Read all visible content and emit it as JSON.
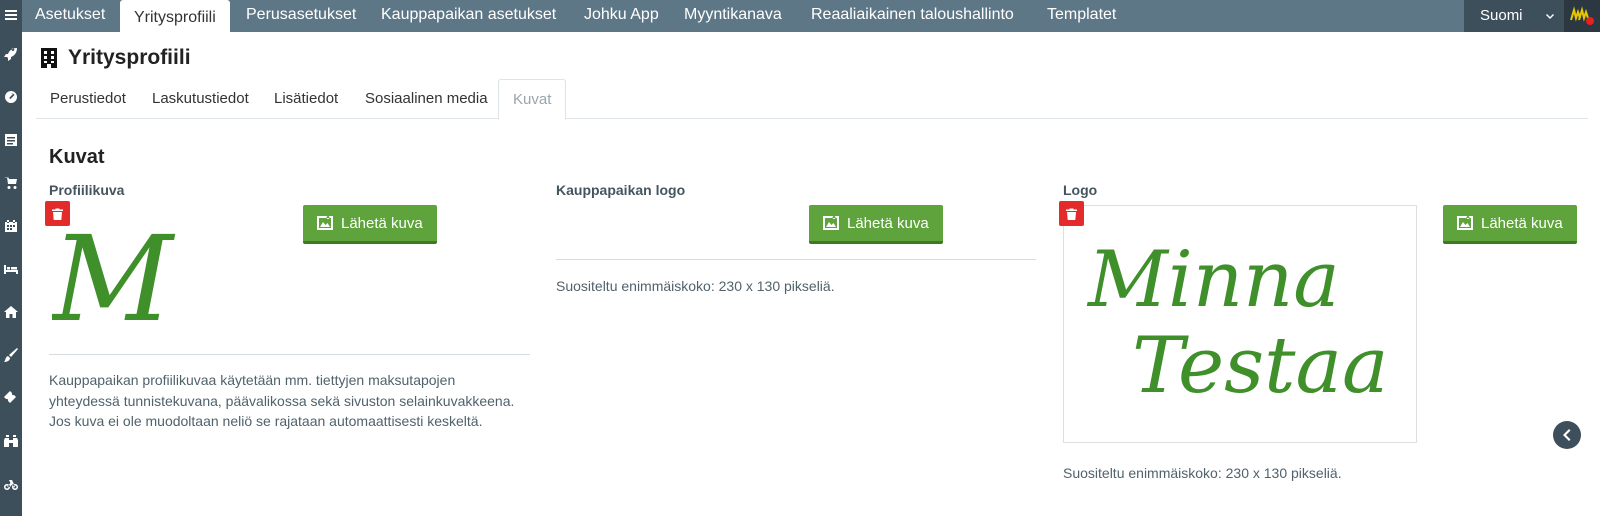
{
  "topnav": {
    "tabs": [
      {
        "label": "Asetukset"
      },
      {
        "label": "Yritysprofiili",
        "active": true
      },
      {
        "label": "Perusasetukset"
      },
      {
        "label": "Kauppapaikan asetukset"
      },
      {
        "label": "Johku App"
      },
      {
        "label": "Myyntikanava"
      },
      {
        "label": "Reaaliaikainen taloushallinto"
      },
      {
        "label": "Templatet"
      }
    ],
    "language": "Suomi"
  },
  "sidebar": {
    "icons": [
      "menu-icon",
      "rocket-icon",
      "dashboard-icon",
      "document-icon",
      "cart-icon",
      "calendar-icon",
      "bed-icon",
      "home-icon",
      "brush-icon",
      "ticket-icon",
      "binoculars-icon",
      "bicycle-icon"
    ]
  },
  "page": {
    "title": "Yritysprofiili"
  },
  "subtabs": [
    {
      "label": "Perustiedot"
    },
    {
      "label": "Laskutustiedot"
    },
    {
      "label": "Lisätiedot"
    },
    {
      "label": "Sosiaalinen media"
    },
    {
      "label": "Kuvat",
      "active": true
    }
  ],
  "section": {
    "title": "Kuvat"
  },
  "columns": {
    "profile": {
      "label": "Profiilikuva",
      "upload_label": "Lähetä kuva",
      "image_text": "M",
      "help_lines": [
        "Kauppapaikan profiilikuvaa käytetään mm. tiettyjen maksutapojen",
        "yhteydessä tunnistekuvana, päävalikossa sekä sivuston selainkuvakkeena.",
        "Jos kuva ei ole muodoltaan neliö se rajataan automaattisesti keskeltä."
      ]
    },
    "marketplace_logo": {
      "label": "Kauppapaikan logo",
      "upload_label": "Lähetä kuva",
      "help": "Suositeltu enimmäiskoko: 230 x 130 pikseliä."
    },
    "logo": {
      "label": "Logo",
      "upload_label": "Lähetä kuva",
      "image_lines": [
        "Minna",
        "Testaa"
      ],
      "help": "Suositeltu enimmäiskoko: 230 x 130 pikseliä."
    }
  },
  "colors": {
    "nav": "#5d7786",
    "rail": "#3e4f5c",
    "primary_button": "#5ea33b",
    "danger": "#e32b2b",
    "logo_green": "#3f8f2a"
  }
}
